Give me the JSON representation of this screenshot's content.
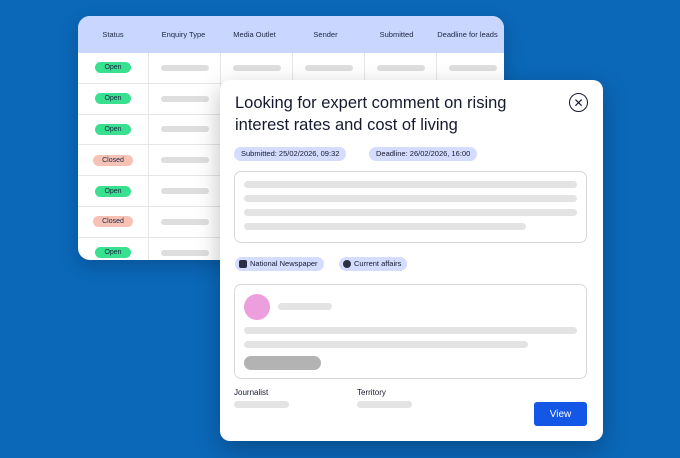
{
  "table": {
    "columns": [
      "Status",
      "Enquiry Type",
      "Media Outlet",
      "Sender",
      "Submitted",
      "Deadline for leads"
    ],
    "rows": [
      {
        "status": "Open",
        "status_type": "open"
      },
      {
        "status": "Open",
        "status_type": "open"
      },
      {
        "status": "Open",
        "status_type": "open"
      },
      {
        "status": "Closed",
        "status_type": "closed"
      },
      {
        "status": "Open",
        "status_type": "open"
      },
      {
        "status": "Closed",
        "status_type": "closed"
      },
      {
        "status": "Open",
        "status_type": "open"
      }
    ]
  },
  "modal": {
    "title": "Looking for expert comment on rising interest rates and cost of living",
    "submitted": "Submitted: 25/02/2026, 09:32",
    "deadline": "Deadline: 26/02/2026, 16:00",
    "tags": [
      {
        "label": "National Newspaper",
        "icon": "newspaper-icon"
      },
      {
        "label": "Current affairs",
        "icon": "topic-icon"
      }
    ],
    "journalist_label": "Journalist",
    "territory_label": "Territory",
    "view_label": "View",
    "close_icon": "close-icon"
  },
  "colors": {
    "background": "#0b67b8",
    "table_header": "#c9d6ff",
    "open_badge": "#38e08f",
    "closed_badge": "#f6c2b5",
    "chip": "#d4dcff",
    "avatar": "#ec9fdc",
    "primary_button": "#1457e6"
  }
}
